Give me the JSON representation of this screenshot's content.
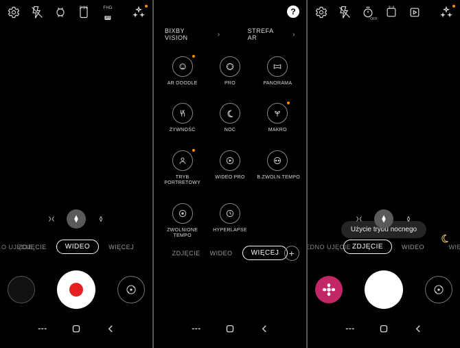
{
  "screen1": {
    "topbar": {
      "settings_icon": "settings",
      "flash_icon": "flash-off",
      "timer_icon": "timer",
      "ratio_label": "9:16",
      "res_top": "FHD",
      "res_bot": "30",
      "effects_icon": "magic"
    },
    "tabs": {
      "left_edge": "O UJĘCIE",
      "items": [
        "ZDJĘCIE",
        "WIDEO",
        "WIĘCEJ"
      ],
      "selected": "WIDEO"
    }
  },
  "screen2": {
    "help": "?",
    "links": {
      "bixby": "BIXBY VISION",
      "ar": "STREFA AR"
    },
    "modes": [
      {
        "id": "ar-doodle",
        "label": "AR DOODLE",
        "dot": true
      },
      {
        "id": "pro",
        "label": "PRO",
        "dot": false
      },
      {
        "id": "panorama",
        "label": "PANORAMA",
        "dot": false
      },
      {
        "id": "food",
        "label": "ŻYWNOŚĆ",
        "dot": false
      },
      {
        "id": "night",
        "label": "NOC",
        "dot": false
      },
      {
        "id": "macro",
        "label": "MAKRO",
        "dot": true
      },
      {
        "id": "portrait",
        "label": "TRYB PORTRETOWY",
        "dot": true
      },
      {
        "id": "video-pro",
        "label": "WIDEO PRO",
        "dot": false
      },
      {
        "id": "super-slow",
        "label": "B.ZWOLN.TEMPO",
        "dot": false
      },
      {
        "id": "slow-mo",
        "label": "ZWOLNIONE TEMPO",
        "dot": false
      },
      {
        "id": "hyperlapse",
        "label": "HYPERLAPSE",
        "dot": false
      }
    ],
    "tabs": {
      "items": [
        "ZDJĘCIE",
        "WIDEO",
        "WIĘCEJ"
      ],
      "selected": "WIĘCEJ",
      "add": "+"
    }
  },
  "screen3": {
    "topbar": {
      "settings_icon": "settings",
      "flash_icon": "flash-off",
      "timer_icon": "timer-off",
      "ratio_label": "3:4",
      "motion_icon": "motion-photo",
      "effects_icon": "magic"
    },
    "toast": "Użycie trybu nocnego",
    "tabs": {
      "left_edge": "JEDNO UJĘCIE",
      "right_edge": "WIĘ",
      "items": [
        "ZDJĘCIE",
        "WIDEO"
      ],
      "selected": "ZDJĘCIE"
    }
  }
}
